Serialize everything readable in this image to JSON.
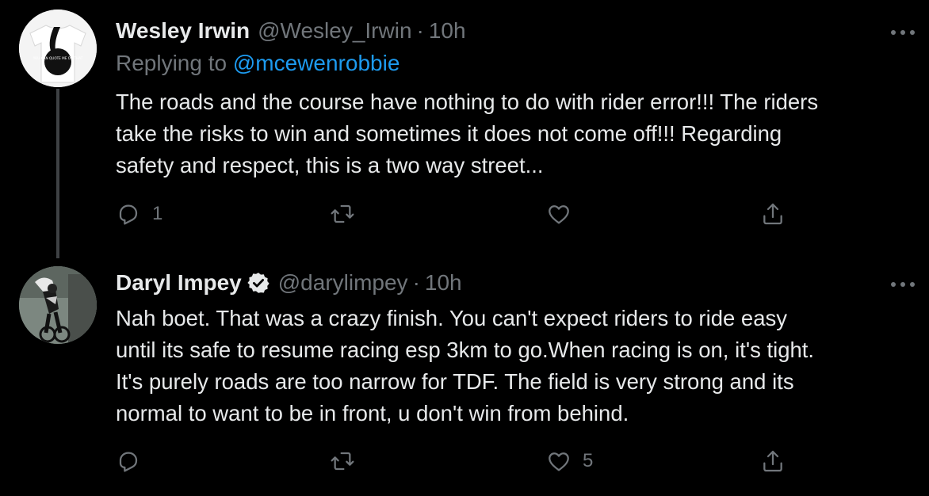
{
  "tweets": [
    {
      "name": "Wesley Irwin",
      "handle": "@Wesley_Irwin",
      "separator": "·",
      "time": "10h",
      "verified": false,
      "replying_label": "Replying to",
      "replying_to": "@mcewenrobbie",
      "avatar_text": "YOU CAN QUOTE ME ON THAT",
      "text_lines": [
        "The roads and the course have nothing to do with rider error!!! The riders",
        "take the risks to win and sometimes it does not come off!!! Regarding",
        "safety and respect, this is a two way street..."
      ],
      "replies": "1",
      "retweets": "",
      "likes": ""
    },
    {
      "name": "Daryl Impey",
      "handle": "@darylimpey",
      "separator": "·",
      "time": "10h",
      "verified": true,
      "text_lines": [
        "Nah boet. That was a crazy finish. You can't expect riders to ride easy",
        "until its safe to resume racing esp 3km to go.When racing is on, it's tight.",
        "It's purely roads are too narrow for TDF. The field is very strong and its",
        "normal to want to be in front, u don't win from behind."
      ],
      "replies": "",
      "retweets": "",
      "likes": "5"
    }
  ],
  "colors": {
    "background": "#000000",
    "text": "#e7e9ea",
    "muted": "#71767b",
    "accent": "#1d9bf0",
    "thread_line": "#3e4144"
  },
  "icons": [
    "reply-icon",
    "retweet-icon",
    "like-icon",
    "share-icon",
    "more-icon",
    "verified-icon"
  ]
}
